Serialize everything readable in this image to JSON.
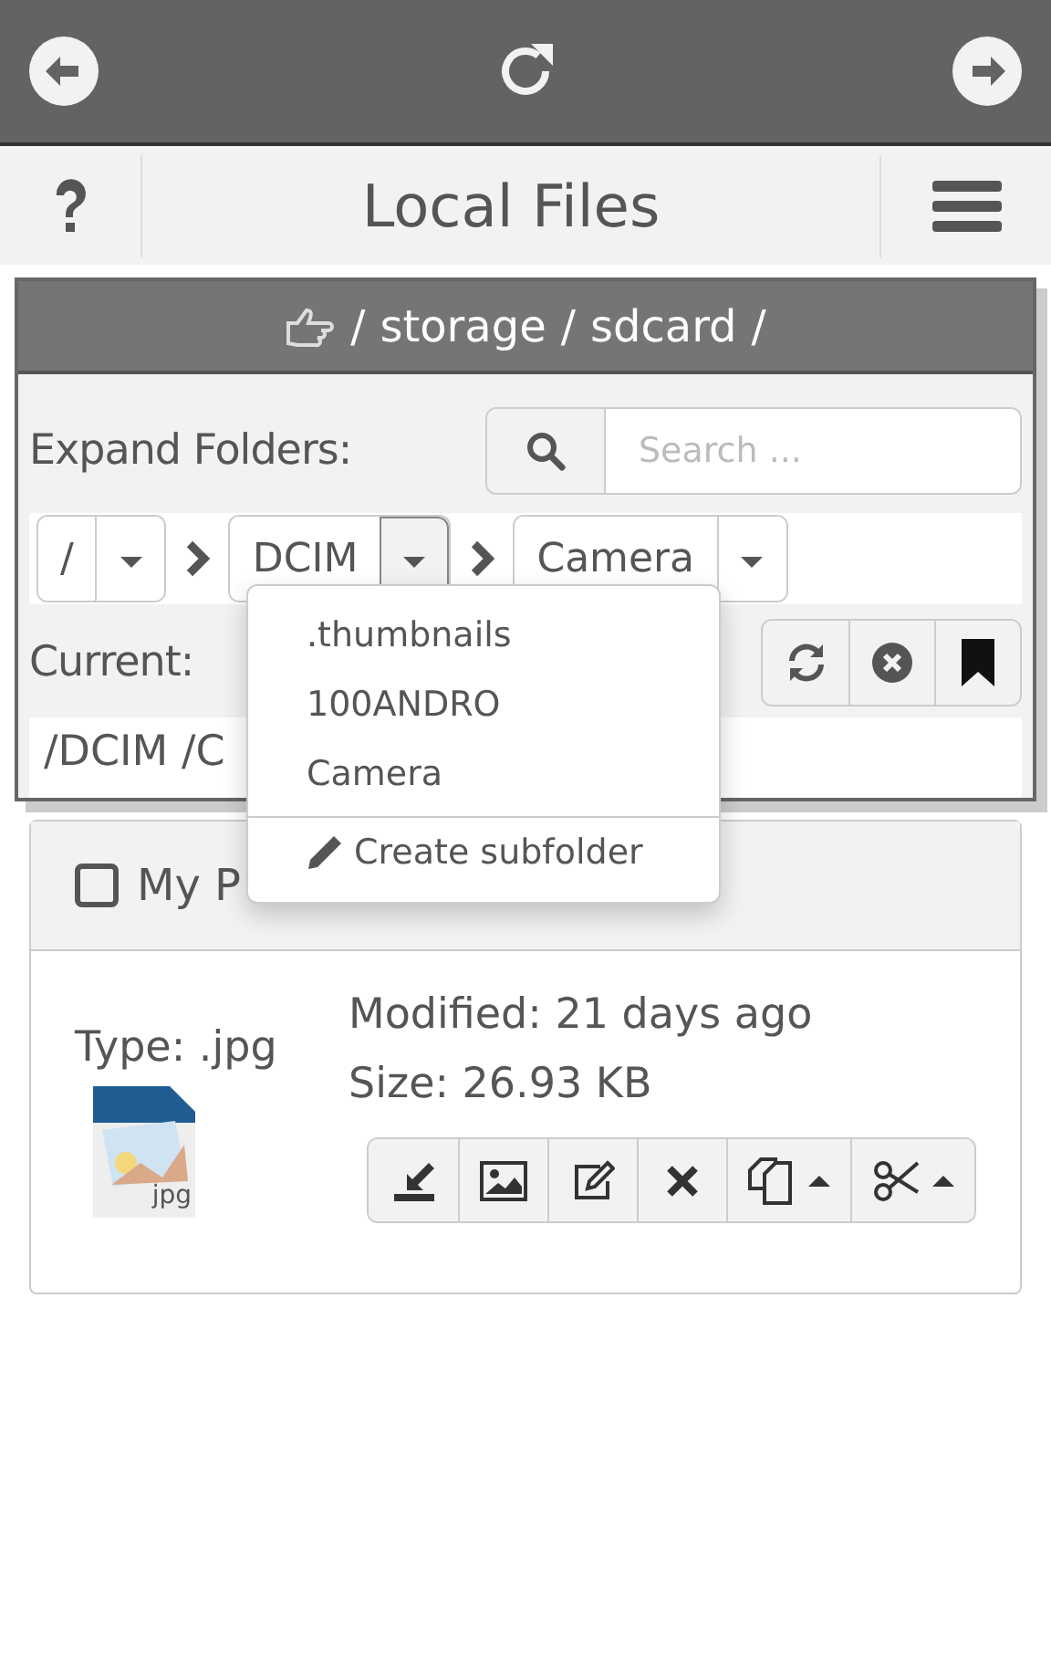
{
  "header": {
    "title": "Local Files"
  },
  "path_bar": {
    "segments": [
      "/",
      "storage",
      "/",
      "sdcard",
      "/"
    ]
  },
  "expand": {
    "label": "Expand Folders:",
    "search_placeholder": "Search ..."
  },
  "breadcrumbs": [
    {
      "label": "/",
      "open": false
    },
    {
      "label": "DCIM",
      "open": true
    },
    {
      "label": "Camera",
      "open": false
    }
  ],
  "current": {
    "label": "Current:",
    "path": "/DCIM /C"
  },
  "folder_menu": {
    "items": [
      ".thumbnails",
      "100ANDRO",
      "Camera"
    ],
    "create": "Create subfolder"
  },
  "file": {
    "name": "My P",
    "checked": false,
    "type": "Type: .jpg",
    "icon_label": "jpg",
    "modified": "Modified: 21 days ago",
    "size": "Size: 26.93 KB"
  }
}
